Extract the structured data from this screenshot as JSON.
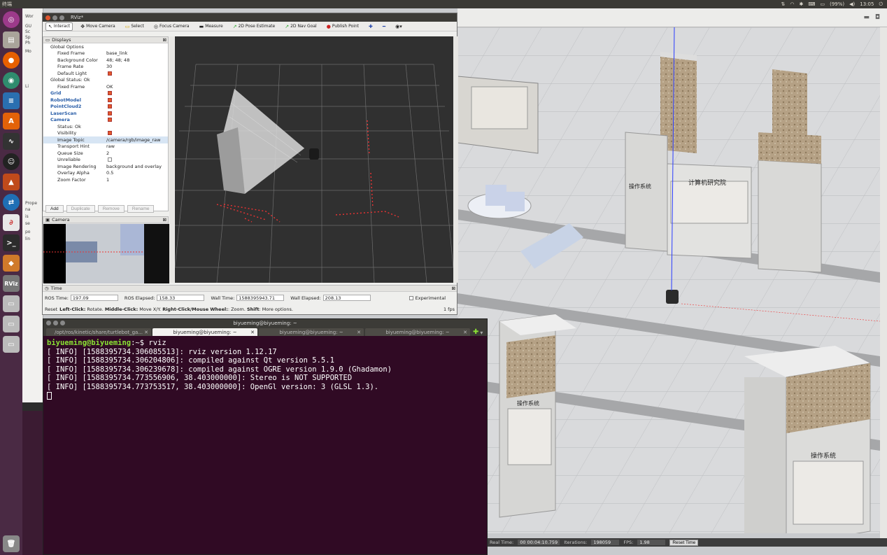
{
  "topbar": {
    "title": "终端",
    "battery": "(99%)",
    "time": "13:05"
  },
  "gazebo": {
    "left_labels": [
      "Wor",
      "GU",
      "Sc",
      "Sp",
      "Ph",
      "Mo",
      "Li",
      "Prope",
      "na",
      "is",
      "se",
      "po",
      "lin"
    ],
    "status": {
      "real_time_label": "Real Time:",
      "real_time": "00 00:04:10.759",
      "iterations_label": "Iterations:",
      "iterations": "198059",
      "fps_label": "FPS:",
      "fps": "1.98",
      "reset_button": "Reset Time"
    },
    "signs": [
      "操作系统",
      "计算机研究院",
      "操作系统",
      "操作系统"
    ]
  },
  "rviz": {
    "title": "RViz*",
    "toolbar": [
      "Interact",
      "Move Camera",
      "Select",
      "Focus Camera",
      "Measure",
      "2D Pose Estimate",
      "2D Nav Goal",
      "Publish Point"
    ],
    "displays_title": "Displays",
    "rows": [
      {
        "k": "Global Options",
        "v": "",
        "indent": 1
      },
      {
        "k": "Fixed Frame",
        "v": "base_link",
        "indent": 2
      },
      {
        "k": "Background Color",
        "v": "48; 48; 48",
        "indent": 2
      },
      {
        "k": "Frame Rate",
        "v": "30",
        "indent": 2
      },
      {
        "k": "Default Light",
        "v": "",
        "indent": 2,
        "check": true
      },
      {
        "k": "Global Status: Ok",
        "v": "",
        "indent": 1
      },
      {
        "k": "Fixed Frame",
        "v": "OK",
        "indent": 2
      },
      {
        "k": "Grid",
        "v": "",
        "indent": 1,
        "check": true,
        "blue": true
      },
      {
        "k": "RobotModel",
        "v": "",
        "indent": 1,
        "check": true,
        "blue": true
      },
      {
        "k": "PointCloud2",
        "v": "",
        "indent": 1,
        "check": true,
        "blue": true
      },
      {
        "k": "LaserScan",
        "v": "",
        "indent": 1,
        "check": true,
        "blue": true
      },
      {
        "k": "Camera",
        "v": "",
        "indent": 1,
        "check": true,
        "blue": true
      },
      {
        "k": "Status: Ok",
        "v": "",
        "indent": 2
      },
      {
        "k": "Visibility",
        "v": "",
        "indent": 2,
        "check": true
      },
      {
        "k": "Image Topic",
        "v": "/camera/rgb/image_raw",
        "indent": 2,
        "sel": true
      },
      {
        "k": "Transport Hint",
        "v": "raw",
        "indent": 2
      },
      {
        "k": "Queue Size",
        "v": "2",
        "indent": 2
      },
      {
        "k": "Unreliable",
        "v": "",
        "indent": 2,
        "uncheck": true
      },
      {
        "k": "Image Rendering",
        "v": "background and overlay",
        "indent": 2
      },
      {
        "k": "Overlay Alpha",
        "v": "0.5",
        "indent": 2
      },
      {
        "k": "Zoom Factor",
        "v": "1",
        "indent": 2
      }
    ],
    "buttons": {
      "add": "Add",
      "duplicate": "Duplicate",
      "remove": "Remove",
      "rename": "Rename"
    },
    "camera_title": "Camera",
    "time_title": "Time",
    "time": {
      "ros_time_label": "ROS Time:",
      "ros_time": "197.09",
      "ros_elapsed_label": "ROS Elapsed:",
      "ros_elapsed": "158.33",
      "wall_time_label": "Wall Time:",
      "wall_time": "1588395943.71",
      "wall_elapsed_label": "Wall Elapsed:",
      "wall_elapsed": "208.13",
      "experimental": "Experimental"
    },
    "hint": {
      "reset": "Reset",
      "lc": "Left-Click:",
      "lc_t": " Rotate. ",
      "mc": "Middle-Click:",
      "mc_t": " Move X/Y. ",
      "rc": "Right-Click/Mouse Wheel:",
      "rc_t": ": Zoom. ",
      "sh": "Shift",
      "sh_t": ": More options.",
      "fps": "1 fps"
    }
  },
  "terminal": {
    "title": "biyueming@biyueming: ~",
    "tabs": [
      "/opt/ros/kinetic/share/turtlebot_ga...",
      "biyueming@biyueming: ~",
      "biyueming@biyueming: ~",
      "biyueming@biyueming: ~"
    ],
    "prompt": "biyueming@biyueming",
    "prompt_path": ":~$ ",
    "command": "rviz",
    "lines": [
      "[ INFO] [1588395734.306085513]: rviz version 1.12.17",
      "[ INFO] [1588395734.306204806]: compiled against Qt version 5.5.1",
      "[ INFO] [1588395734.306239678]: compiled against OGRE version 1.9.0 (Ghadamon)",
      "[ INFO] [1588395734.773556906, 38.403000000]: Stereo is NOT SUPPORTED",
      "[ INFO] [1588395734.773753517, 38.403000000]: OpenGl version: 3 (GLSL 1.3)."
    ]
  }
}
